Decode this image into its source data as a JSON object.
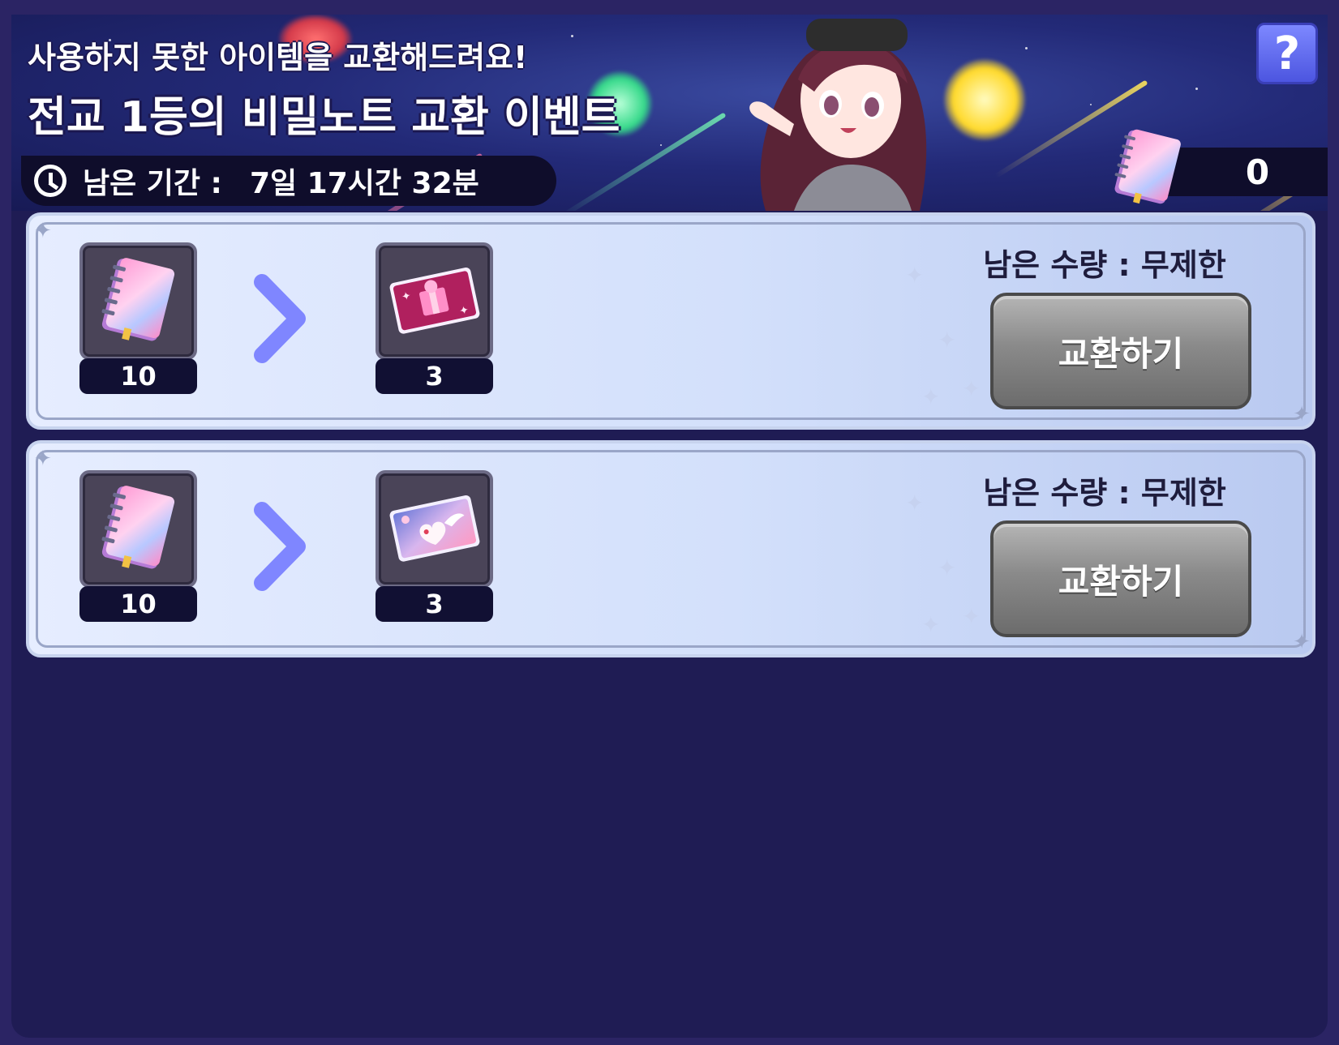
{
  "banner": {
    "subtitle": "사용하지 못한 아이템을 교환해드려요!",
    "title": "전교 1등의 비밀노트 교환 이벤트",
    "timer_label": "남은 기간 :",
    "timer_value": "7일 17시간 32분",
    "help_label": "?",
    "currency_count": "0",
    "currency_icon": "secret-notebook-icon"
  },
  "exchanges": [
    {
      "cost_item": "secret-notebook-icon",
      "cost_count": "10",
      "reward_item": "pink-gift-ticket-icon",
      "reward_count": "3",
      "remaining": "남은 수량 : 무제한",
      "button_label": "교환하기"
    },
    {
      "cost_item": "secret-notebook-icon",
      "cost_count": "10",
      "reward_item": "winged-heart-card-icon",
      "reward_count": "3",
      "remaining": "남은 수량 : 무제한",
      "button_label": "교환하기"
    }
  ],
  "colors": {
    "background": "#1f1c54",
    "row_bg": "#d3e0fb",
    "button_gray": "#8a8a8a",
    "arrow": "#7f86ff",
    "help_blue": "#5c66ee"
  }
}
